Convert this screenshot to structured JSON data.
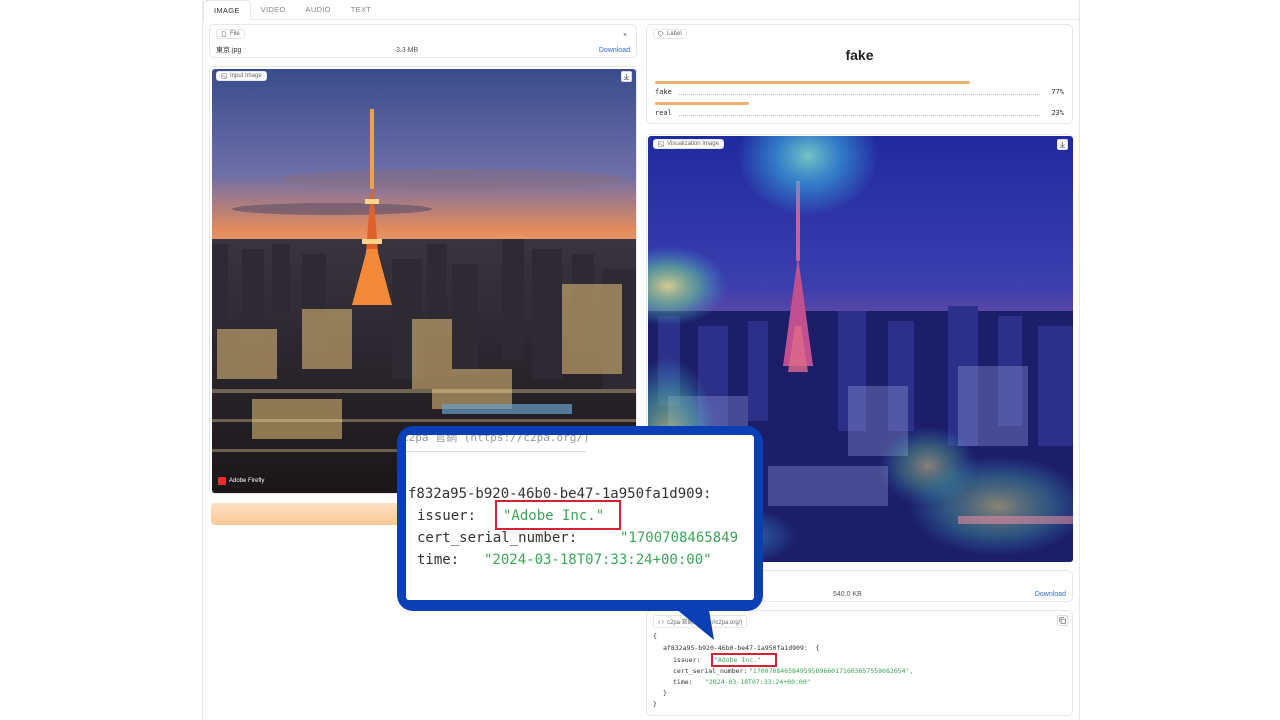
{
  "tabs": [
    {
      "label": "IMAGE",
      "active": true
    },
    {
      "label": "VIDEO",
      "active": false
    },
    {
      "label": "AUDIO",
      "active": false
    },
    {
      "label": "TEXT",
      "active": false
    }
  ],
  "file_block": {
    "label": "File",
    "name": "東京.jpg",
    "size": "3.3 MB",
    "download": "Download",
    "close": "×"
  },
  "input_image": {
    "label": "Input Image",
    "watermark": "Adobe Firefly"
  },
  "label_block": {
    "label": "Label",
    "title": "fake",
    "confidences": [
      {
        "label": "fake",
        "value": 0.77,
        "pct": "77%"
      },
      {
        "label": "real",
        "value": 0.23,
        "pct": "23%"
      }
    ]
  },
  "viz_image": {
    "label": "Visualization Image"
  },
  "output_file": {
    "name_partial": "...D...",
    "size": "540.0 KB",
    "download": "Download"
  },
  "c2pa_block": {
    "label": "c2pa 官網 (https://c2pa.org/)",
    "open_brace": "{",
    "key": "af832a95-b920-46b0-be47-1a950fa1d909:  {",
    "issuer_key": "issuer:",
    "issuer_val": "\"Adobe Inc.\"",
    "cert_key": "cert_serial_number:",
    "cert_val": "\"170070846584959589660171603657559082654\",",
    "time_key": "time:",
    "time_val": "\"2024-03-18T07:33:24+00:00\"",
    "close_inner": "}",
    "close_outer": "}"
  },
  "callout": {
    "header_partial": "c2pa 官網 (https://c2pa.org/)",
    "key": "f832a95-b920-46b0-be47-1a950fa1d909:",
    "issuer_key": "issuer:",
    "issuer_val": "\"Adobe Inc.\"",
    "cert_key": "cert_serial_number:",
    "cert_val": "\"1700708465849",
    "time_key": "time:",
    "time_val": "\"2024-03-18T07:33:24+00:00\""
  },
  "colors": {
    "accent_bar": "#f0b070",
    "download_link": "#2f6fd6",
    "string_green": "#3aa757",
    "callout_blue": "#0b3fb5",
    "highlight_red": "#d42233"
  }
}
